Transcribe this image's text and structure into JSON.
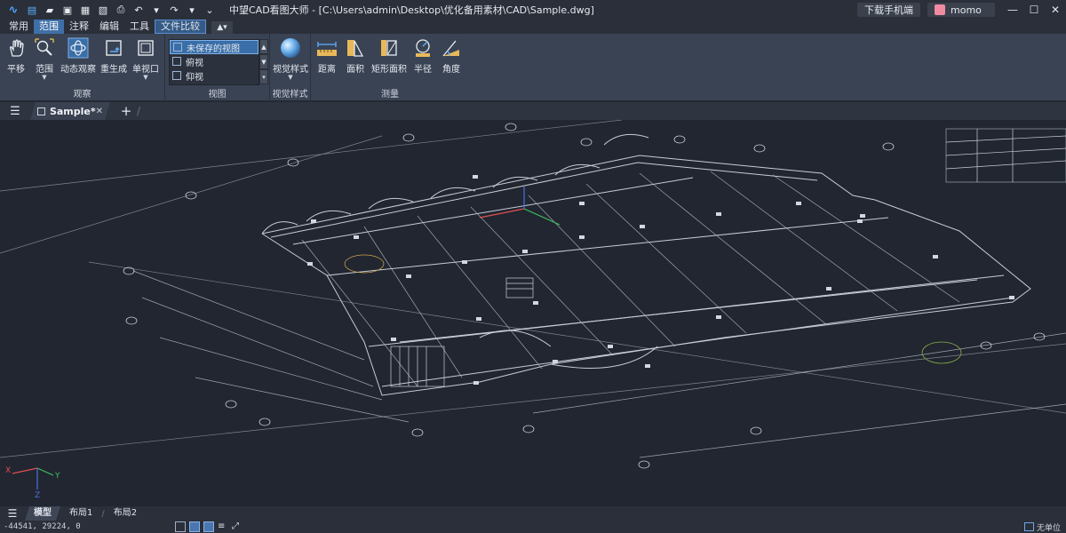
{
  "app": {
    "title": "中望CAD看图大师 - [C:\\Users\\admin\\Desktop\\优化备用素材\\CAD\\Sample.dwg]",
    "download_label": "下载手机端",
    "user_name": "momo",
    "window_controls": [
      "minimize-icon",
      "restore-icon",
      "close-icon"
    ]
  },
  "ribbon_tabs": [
    {
      "label": "常用",
      "state": "normal"
    },
    {
      "label": "范围",
      "state": "active"
    },
    {
      "label": "注释",
      "state": "normal"
    },
    {
      "label": "编辑",
      "state": "normal"
    },
    {
      "label": "工具",
      "state": "normal"
    },
    {
      "label": "文件比较",
      "state": "boxed"
    }
  ],
  "ribbon": {
    "observe": {
      "label": "观察",
      "tools": [
        {
          "label": "平移",
          "icon": "hand-icon"
        },
        {
          "label": "范围",
          "icon": "zoom-extents-icon"
        },
        {
          "label": "动态观察",
          "icon": "orbit-icon"
        },
        {
          "label": "重生成",
          "icon": "regen-icon"
        },
        {
          "label": "单视口",
          "icon": "single-viewport-icon"
        }
      ]
    },
    "view": {
      "label": "视图",
      "items": [
        "未保存的视图",
        "俯视",
        "仰视"
      ]
    },
    "visual_style": {
      "label": "视觉样式",
      "tool_label": "视觉样式"
    },
    "measure": {
      "label": "测量",
      "tools": [
        {
          "label": "距离",
          "icon": "distance-icon"
        },
        {
          "label": "面积",
          "icon": "area-icon"
        },
        {
          "label": "矩形面积",
          "icon": "rect-area-icon"
        },
        {
          "label": "半径",
          "icon": "radius-icon"
        },
        {
          "label": "角度",
          "icon": "angle-icon"
        }
      ]
    }
  },
  "doc_tabs": [
    {
      "label": "Sample*",
      "active": true
    }
  ],
  "layout_tabs": [
    {
      "label": "模型",
      "active": true
    },
    {
      "label": "布局1",
      "active": false
    },
    {
      "label": "布局2",
      "active": false
    }
  ],
  "status": {
    "coordinates": "-44541, 29224, 0",
    "units_label": "无单位"
  },
  "ucs": {
    "x": "X",
    "y": "Y",
    "z": "Z"
  },
  "colors": {
    "accent": "#3f6fa8",
    "canvas_bg": "#212631",
    "drawing_line": "#c8ccd4",
    "ucs_x": "#e05050",
    "ucs_y": "#40c060",
    "ucs_z": "#5070e0"
  }
}
